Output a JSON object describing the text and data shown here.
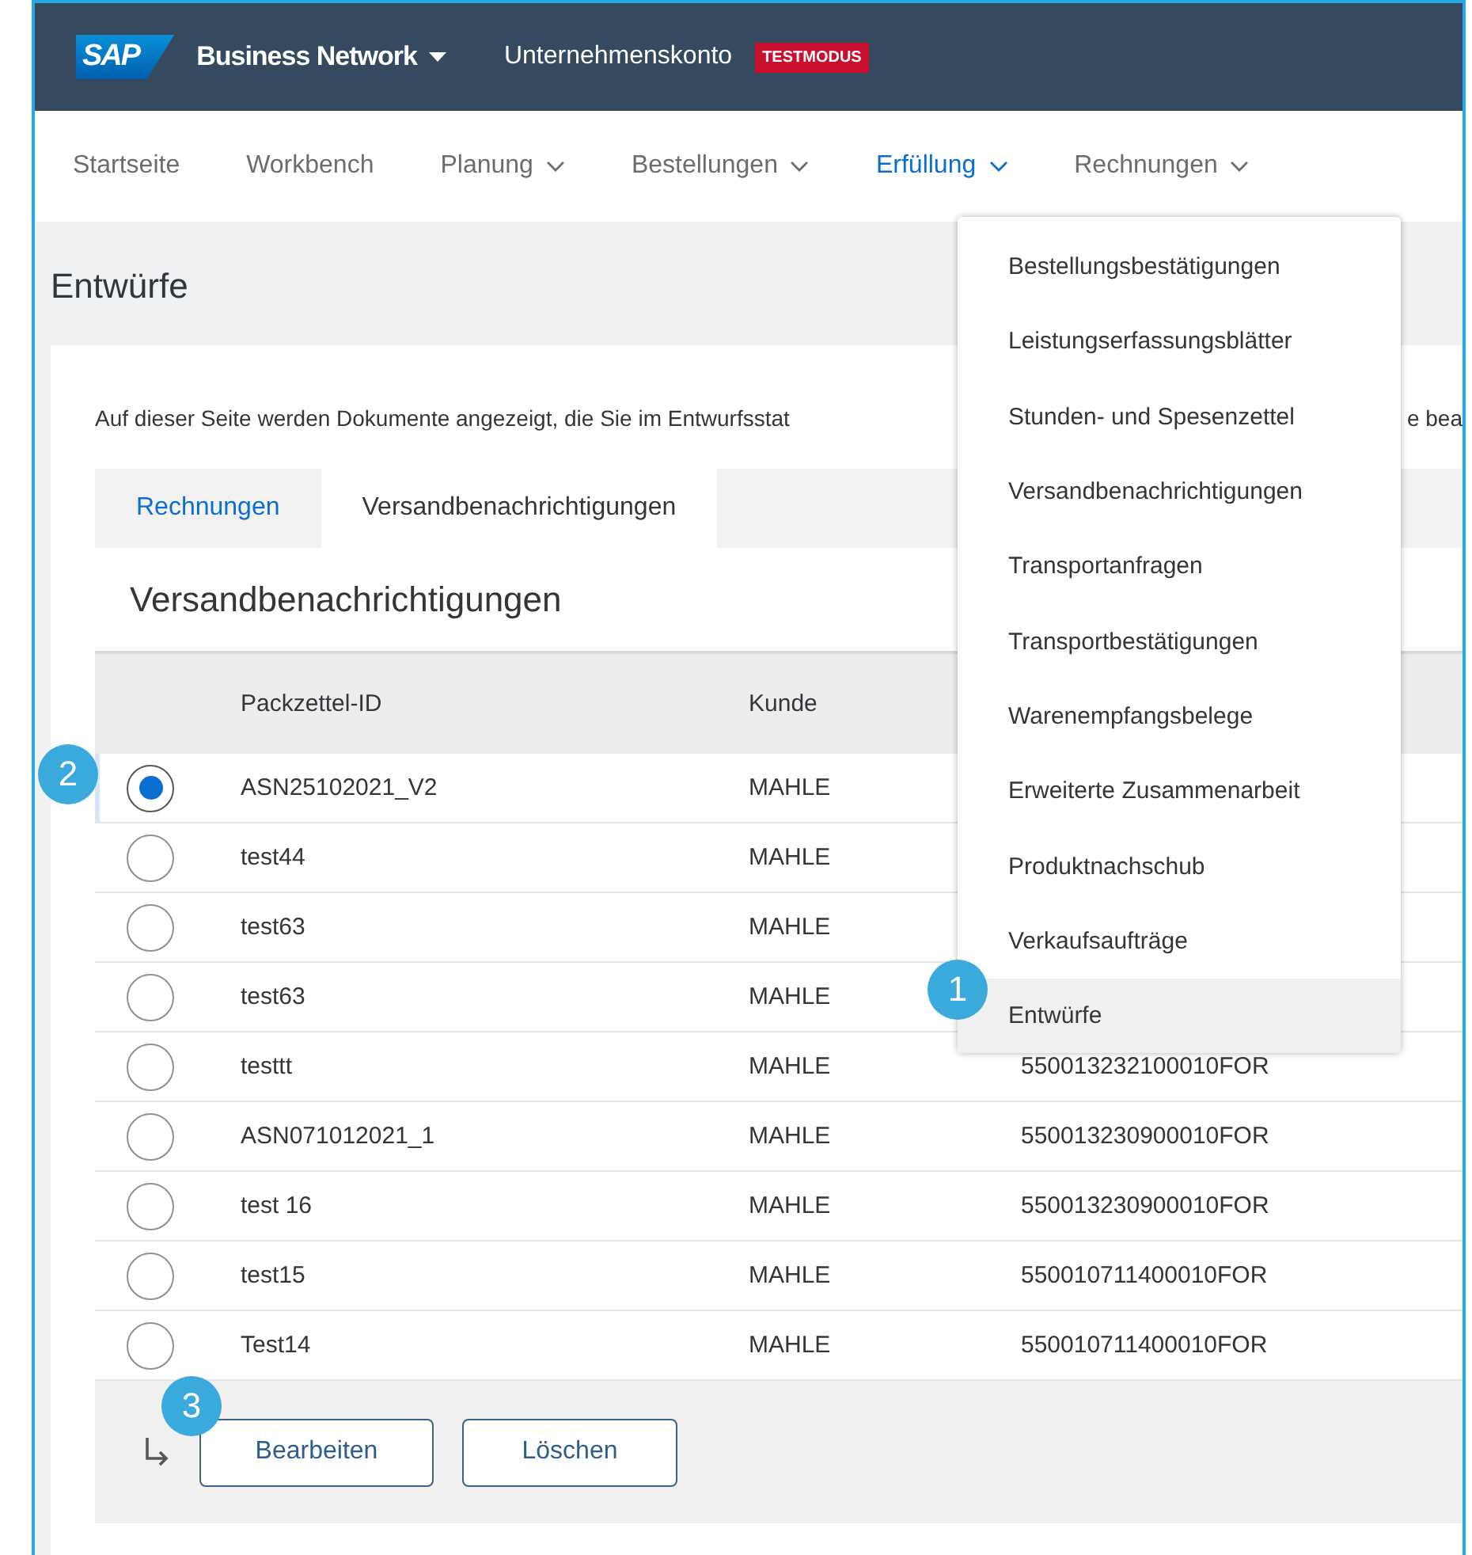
{
  "header": {
    "logo": "SAP",
    "product": "Business Network",
    "account": "Unternehmenskonto",
    "mode_badge": "TESTMODUS"
  },
  "nav": [
    {
      "label": "Startseite",
      "has_menu": false,
      "selected": false
    },
    {
      "label": "Workbench",
      "has_menu": false,
      "selected": false
    },
    {
      "label": "Planung",
      "has_menu": true,
      "selected": false
    },
    {
      "label": "Bestellungen",
      "has_menu": true,
      "selected": false
    },
    {
      "label": "Erfüllung",
      "has_menu": true,
      "selected": true
    },
    {
      "label": "Rechnungen",
      "has_menu": true,
      "selected": false
    }
  ],
  "dropdown": {
    "items": [
      {
        "label": "Bestellungsbestätigungen",
        "selected": false
      },
      {
        "label": "Leistungserfassungsblätter",
        "selected": false
      },
      {
        "label": "Stunden- und Spesenzettel",
        "selected": false
      },
      {
        "label": "Versandbenachrichtigungen",
        "selected": false
      },
      {
        "label": "Transportanfragen",
        "selected": false
      },
      {
        "label": "Transportbestätigungen",
        "selected": false
      },
      {
        "label": "Warenempfangsbelege",
        "selected": false
      },
      {
        "label": "Erweiterte Zusammenarbeit",
        "selected": false
      },
      {
        "label": "Produktnachschub",
        "selected": false
      },
      {
        "label": "Verkaufsaufträge",
        "selected": false
      },
      {
        "label": "Entwürfe",
        "selected": true,
        "callout": "1"
      }
    ]
  },
  "page_title": "Entwürfe",
  "description": {
    "left": "Auf dieser Seite werden Dokumente angezeigt, die Sie im Entwurfsstat",
    "right": "e bea"
  },
  "tabs": [
    {
      "label": "Rechnungen",
      "selected": false
    },
    {
      "label": "Versandbenachrichtigungen",
      "selected": true
    }
  ],
  "section_title": "Versandbenachrichtigungen",
  "table": {
    "columns": [
      "Packzettel-ID",
      "Kunde"
    ],
    "rows": [
      {
        "packzettel_id": "ASN25102021_V2",
        "kunde": "MAHLE",
        "selected": true,
        "callout": "2"
      },
      {
        "packzettel_id": "test44",
        "kunde": "MAHLE",
        "selected": false
      },
      {
        "packzettel_id": "test63",
        "kunde": "MAHLE",
        "selected": false
      },
      {
        "packzettel_id": "test63",
        "kunde": "MAHLE",
        "selected": false
      },
      {
        "packzettel_id": "testtt",
        "kunde": "MAHLE",
        "column_3": "550013232100010FOR",
        "selected": false
      },
      {
        "packzettel_id": "ASN071012021_1",
        "kunde": "MAHLE",
        "column_3": "550013230900010FOR",
        "selected": false
      },
      {
        "packzettel_id": "test 16",
        "kunde": "MAHLE",
        "column_3": "550013230900010FOR",
        "selected": false
      },
      {
        "packzettel_id": "test15",
        "kunde": "MAHLE",
        "column_3": "550010711400010FOR",
        "selected": false
      },
      {
        "packzettel_id": "Test14",
        "kunde": "MAHLE",
        "column_3": "550010711400010FOR",
        "selected": false
      }
    ]
  },
  "actions": [
    {
      "label": "Bearbeiten",
      "callout": "3"
    },
    {
      "label": "Löschen"
    }
  ]
}
